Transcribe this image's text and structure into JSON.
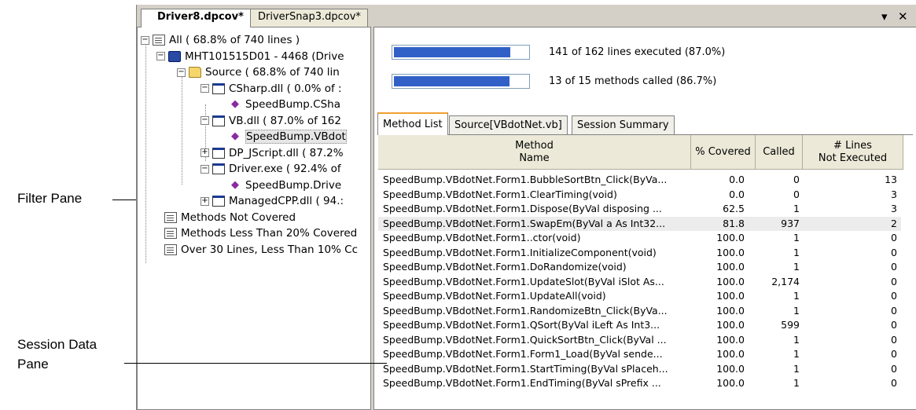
{
  "callouts": {
    "filter_pane": "Filter Pane",
    "session_data_line1": "Session Data",
    "session_data_line2": "Pane"
  },
  "tabs": [
    {
      "label": "Driver8.dpcov*",
      "active": true
    },
    {
      "label": "DriverSnap3.dpcov*",
      "active": false
    }
  ],
  "window_controls": {
    "dropdown": "▾",
    "close": "✕"
  },
  "tree": [
    {
      "pm": "−",
      "icon": "list",
      "label": "All ( 68.8% of 740 lines )"
    },
    {
      "pm": "−",
      "icon": "computer",
      "label": "MHT101515D01 - 4468 (Drive"
    },
    {
      "pm": "−",
      "icon": "folder",
      "label": "Source ( 68.8% of 740 lin"
    },
    {
      "pm": "−",
      "icon": "module",
      "label": "CSharp.dll ( 0.0% of :"
    },
    {
      "pm": "",
      "icon": "class",
      "label": "SpeedBump.CSha"
    },
    {
      "pm": "−",
      "icon": "module",
      "label": "VB.dll ( 87.0% of 162"
    },
    {
      "pm": "",
      "icon": "class",
      "label": "SpeedBump.VBdot"
    },
    {
      "pm": "+",
      "icon": "module",
      "label": "DP_JScript.dll ( 87.2%"
    },
    {
      "pm": "−",
      "icon": "module",
      "label": "Driver.exe ( 92.4% of"
    },
    {
      "pm": "",
      "icon": "class",
      "label": "SpeedBump.Drive"
    },
    {
      "pm": "+",
      "icon": "module",
      "label": "ManagedCPP.dll ( 94.:"
    },
    {
      "pm": "",
      "icon": "list",
      "label": "Methods Not Covered"
    },
    {
      "pm": "",
      "icon": "list",
      "label": "Methods Less Than 20% Covered"
    },
    {
      "pm": "",
      "icon": "list",
      "label": "Over 30 Lines, Less Than 10% Cc"
    }
  ],
  "summary": {
    "lines": {
      "text": "141 of 162 lines executed (87.0%)",
      "progress": 0.87
    },
    "methods": {
      "text": "13 of 15 methods called (86.7%)",
      "progress": 0.867
    }
  },
  "subtabs": [
    "Method List",
    "Source[VBdotNet.vb]",
    "Session Summary"
  ],
  "columns": {
    "method_line1": "Method",
    "method_line2": "Name",
    "covered": "% Covered",
    "called": "Called",
    "lines_line1": "# Lines",
    "lines_line2": "Not Executed"
  },
  "rows": [
    {
      "name": "SpeedBump.VBdotNet.Form1.BubbleSortBtn_Click(ByVa...",
      "covered": "0.0",
      "called": "0",
      "lines": "13"
    },
    {
      "name": "SpeedBump.VBdotNet.Form1.ClearTiming(void)",
      "covered": "0.0",
      "called": "0",
      "lines": "3"
    },
    {
      "name": "SpeedBump.VBdotNet.Form1.Dispose(ByVal disposing ...",
      "covered": "62.5",
      "called": "1",
      "lines": "3"
    },
    {
      "name": "SpeedBump.VBdotNet.Form1.SwapEm(ByVal a As Int32...",
      "covered": "81.8",
      "called": "937",
      "lines": "2",
      "highlight": true
    },
    {
      "name": "SpeedBump.VBdotNet.Form1..ctor(void)",
      "covered": "100.0",
      "called": "1",
      "lines": "0"
    },
    {
      "name": "SpeedBump.VBdotNet.Form1.InitializeComponent(void)",
      "covered": "100.0",
      "called": "1",
      "lines": "0"
    },
    {
      "name": "SpeedBump.VBdotNet.Form1.DoRandomize(void)",
      "covered": "100.0",
      "called": "1",
      "lines": "0"
    },
    {
      "name": "SpeedBump.VBdotNet.Form1.UpdateSlot(ByVal iSlot As...",
      "covered": "100.0",
      "called": "2,174",
      "lines": "0"
    },
    {
      "name": "SpeedBump.VBdotNet.Form1.UpdateAll(void)",
      "covered": "100.0",
      "called": "1",
      "lines": "0"
    },
    {
      "name": "SpeedBump.VBdotNet.Form1.RandomizeBtn_Click(ByVa...",
      "covered": "100.0",
      "called": "1",
      "lines": "0"
    },
    {
      "name": "SpeedBump.VBdotNet.Form1.QSort(ByVal iLeft As Int3...",
      "covered": "100.0",
      "called": "599",
      "lines": "0"
    },
    {
      "name": "SpeedBump.VBdotNet.Form1.QuickSortBtn_Click(ByVal ...",
      "covered": "100.0",
      "called": "1",
      "lines": "0"
    },
    {
      "name": "SpeedBump.VBdotNet.Form1.Form1_Load(ByVal sende...",
      "covered": "100.0",
      "called": "1",
      "lines": "0"
    },
    {
      "name": "SpeedBump.VBdotNet.Form1.StartTiming(ByVal sPlaceh...",
      "covered": "100.0",
      "called": "1",
      "lines": "0"
    },
    {
      "name": "SpeedBump.VBdotNet.Form1.EndTiming(ByVal sPrefix ...",
      "covered": "100.0",
      "called": "1",
      "lines": "0"
    }
  ]
}
